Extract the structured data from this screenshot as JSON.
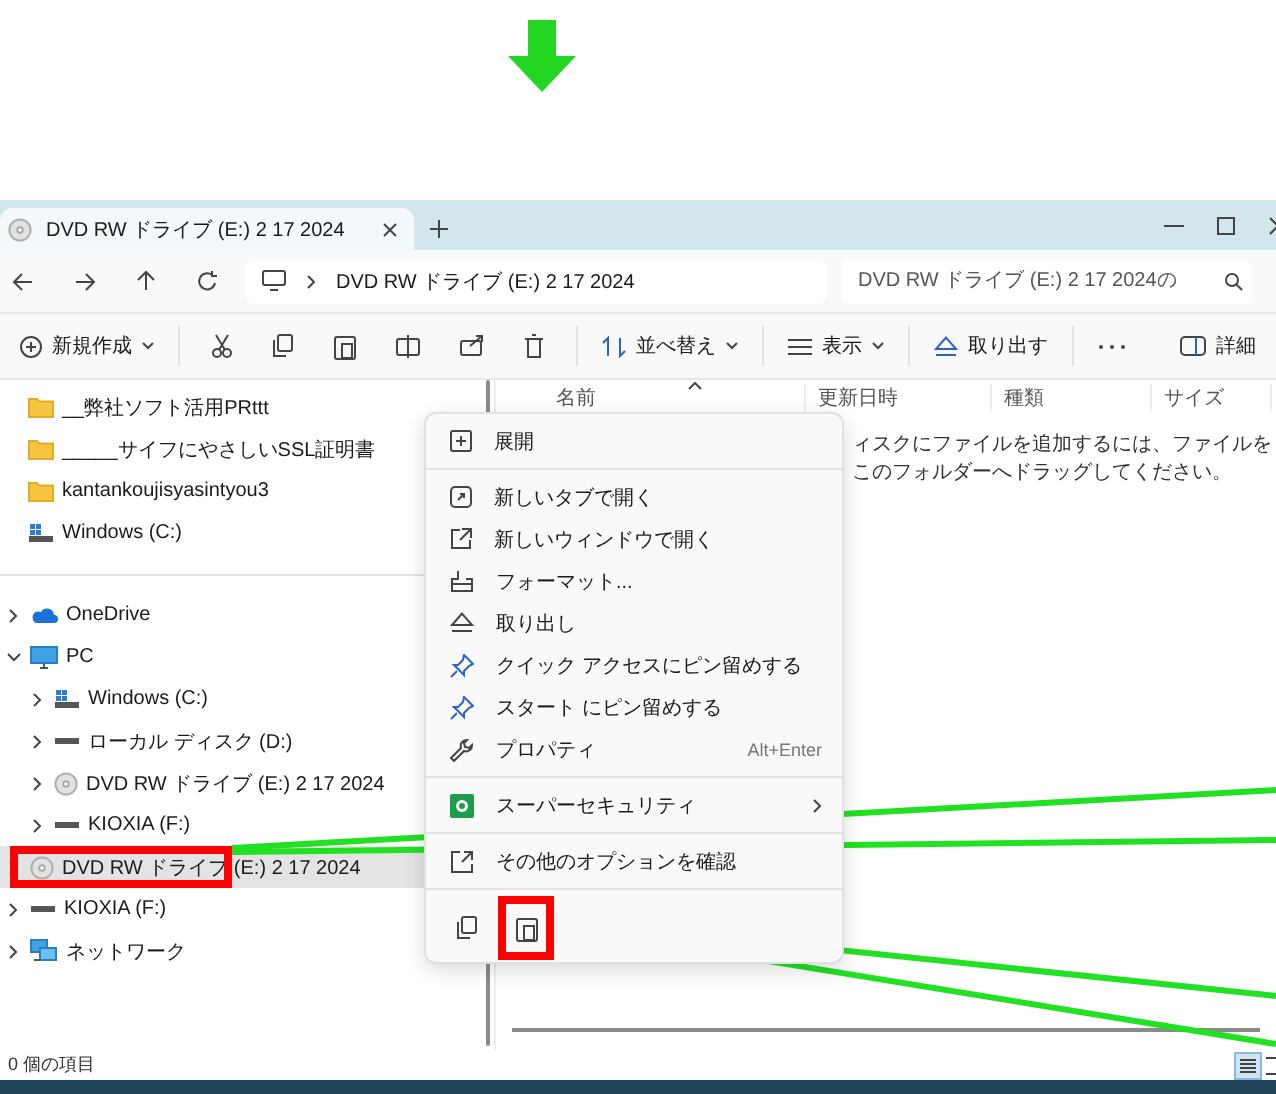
{
  "tab": {
    "title": "DVD RW ドライブ (E:) 2 17 2024"
  },
  "address": {
    "path": "DVD RW ドライブ (E:) 2 17 2024"
  },
  "search": {
    "placeholder": "DVD RW ドライブ (E:) 2 17 2024の"
  },
  "toolbar": {
    "new": "新規作成",
    "sort": "並べ替え",
    "view": "表示",
    "eject": "取り出す",
    "details": "詳細"
  },
  "sidebar": {
    "pinned": [
      {
        "label": "__弊社ソフト活用PRttt",
        "kind": "folder",
        "selected": false
      },
      {
        "label": "_____サイフにやさしいSSL証明書",
        "kind": "folder",
        "selected": false
      },
      {
        "label": "kantankoujisyasintyou3",
        "kind": "folder",
        "selected": false
      },
      {
        "label": "Windows (C:)",
        "kind": "system-drive",
        "selected": false
      }
    ],
    "tree": [
      {
        "label": "OneDrive",
        "kind": "cloud",
        "expanded": false,
        "selected": false
      },
      {
        "label": "PC",
        "kind": "pc",
        "expanded": true,
        "selected": false,
        "children": [
          {
            "label": "Windows (C:)",
            "kind": "system-drive",
            "expanded": false,
            "selected": false
          },
          {
            "label": "ローカル ディスク (D:)",
            "kind": "drive",
            "expanded": false,
            "selected": false
          },
          {
            "label": "DVD RW ドライブ (E:) 2 17 2024",
            "kind": "dvd",
            "expanded": false,
            "selected": false
          },
          {
            "label": "KIOXIA (F:)",
            "kind": "drive",
            "expanded": false,
            "selected": false
          }
        ]
      },
      {
        "label": "DVD RW ドライブ (E:) 2 17 2024",
        "kind": "dvd",
        "expanded": false,
        "selected": true
      },
      {
        "label": "KIOXIA (F:)",
        "kind": "drive",
        "expanded": false,
        "selected": false
      },
      {
        "label": "ネットワーク",
        "kind": "network",
        "expanded": false,
        "selected": false
      }
    ]
  },
  "columns": [
    "名前",
    "更新日時",
    "種類",
    "サイズ"
  ],
  "empty_message": "ィスクにファイルを追加するには、ファイルをこのフォルダーへドラッグしてください。",
  "context_menu": {
    "groups": [
      [
        {
          "label": "展開",
          "submenu": false
        }
      ],
      [
        {
          "label": "新しいタブで開く",
          "submenu": false
        },
        {
          "label": "新しいウィンドウで開く",
          "submenu": false
        },
        {
          "label": "フォーマット...",
          "submenu": false
        },
        {
          "label": "取り出し",
          "submenu": false
        },
        {
          "label": "クイック アクセスにピン留めする",
          "submenu": false
        },
        {
          "label": "スタート にピン留めする",
          "submenu": false
        },
        {
          "label": "プロパティ",
          "shortcut": "Alt+Enter",
          "submenu": false
        }
      ],
      [
        {
          "label": "スーパーセキュリティ",
          "submenu": true
        }
      ],
      [
        {
          "label": "その他のオプションを確認",
          "submenu": false
        }
      ]
    ]
  },
  "status_bar": {
    "text": "0 個の項目"
  }
}
